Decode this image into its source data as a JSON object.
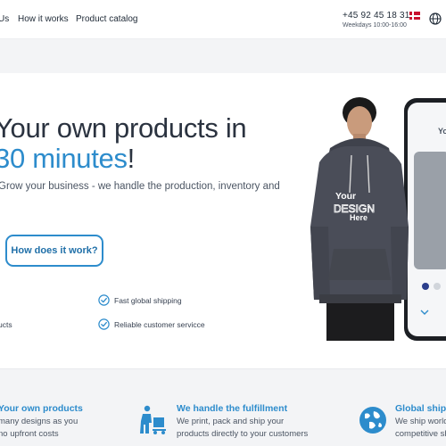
{
  "nav": {
    "items": [
      {
        "label": "Us"
      },
      {
        "label": "How it works"
      },
      {
        "label": "Product catalog"
      }
    ],
    "phone": "+45 92 45 18 31",
    "hours": "Weekdays 10:00-16:00"
  },
  "hero": {
    "title_line1": "Your own products in",
    "title_line2_number": "30",
    "title_line2_word": " minutes",
    "title_line2_punct": "!",
    "subtitle": "Grow your business - we handle the production, inventory and",
    "cta": "How does it work?",
    "features": [
      {
        "label": "Fast global shipping"
      },
      {
        "label": "ucts"
      },
      {
        "label": "Reliable customer servicce"
      }
    ],
    "hoodie_print": {
      "line1": "Your",
      "line2": "DESIGN",
      "line3": "Here"
    },
    "phone_screen_text": "Yo"
  },
  "bottom_features": [
    {
      "title": "Your own products",
      "line1": "many designs as you",
      "line2": "no upfront costs"
    },
    {
      "title": "We handle the fulfillment",
      "line1": "We print, pack and ship your",
      "line2": "products directly to your customers"
    },
    {
      "title": "Global shipp",
      "line1": "We ship worldw",
      "line2": "competitive sh"
    }
  ],
  "colors": {
    "accent": "#2d8ccc",
    "heading": "#2b3340",
    "hoodie": "#4a4d58",
    "background_band": "#f3f4f6"
  }
}
